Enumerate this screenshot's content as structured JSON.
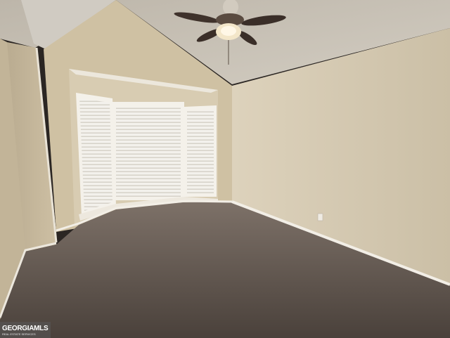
{
  "photo": {
    "subject": "empty-bedroom-with-bay-window-and-ceiling-fan"
  },
  "watermark": {
    "brand": "GEORGIAMLS",
    "tagline": "REAL ESTATE SERVICES"
  },
  "colors": {
    "wall_left": "#cfc2a8",
    "wall_right": "#d8ccb4",
    "ceiling": "#c9c3b8",
    "carpet": "#6e645c",
    "trim": "#eeeae2",
    "blinds": "#f2f0ea",
    "fan_blade": "#3a2e28"
  }
}
